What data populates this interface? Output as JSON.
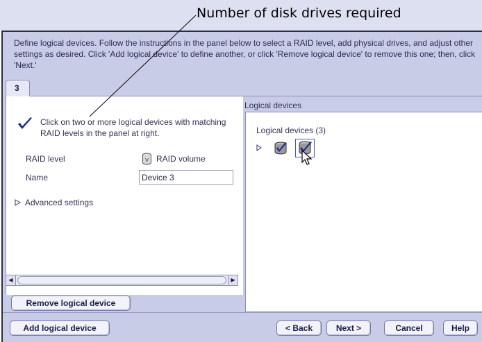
{
  "callout": {
    "text": "Number of disk drives required"
  },
  "instructions": "Define logical devices.  Follow the instructions in the panel below to select a RAID level, add physical drives, and adjust other settings as desired.  Click 'Add logical device' to define another, or click 'Remove logical device' to remove this one; then, click 'Next.'",
  "tab": {
    "label": "3"
  },
  "left_panel": {
    "instruction": "Click on two or more logical devices with matching RAID levels in the panel at right.",
    "raid_level_label": "RAID level",
    "raid_level_value": "RAID volume",
    "name_label": "Name",
    "name_value": "Device 3",
    "advanced_settings": "Advanced settings"
  },
  "right_panel": {
    "header": "Logical devices",
    "tree_title": "Logical devices (3)"
  },
  "buttons": {
    "remove": "Remove logical device",
    "add": "Add logical device",
    "back": "< Back",
    "next": "Next >",
    "cancel": "Cancel",
    "help": "Help"
  },
  "colors": {
    "window_bg": "#c9cce6",
    "check_blue": "#1a2a8c",
    "border": "#8b8fb8"
  },
  "icons": [
    "checkmark-icon",
    "raid-volume-icon",
    "expand-arrow-icon",
    "logical-device-icon",
    "mouse-cursor-icon",
    "scroll-left-icon",
    "scroll-right-icon"
  ]
}
